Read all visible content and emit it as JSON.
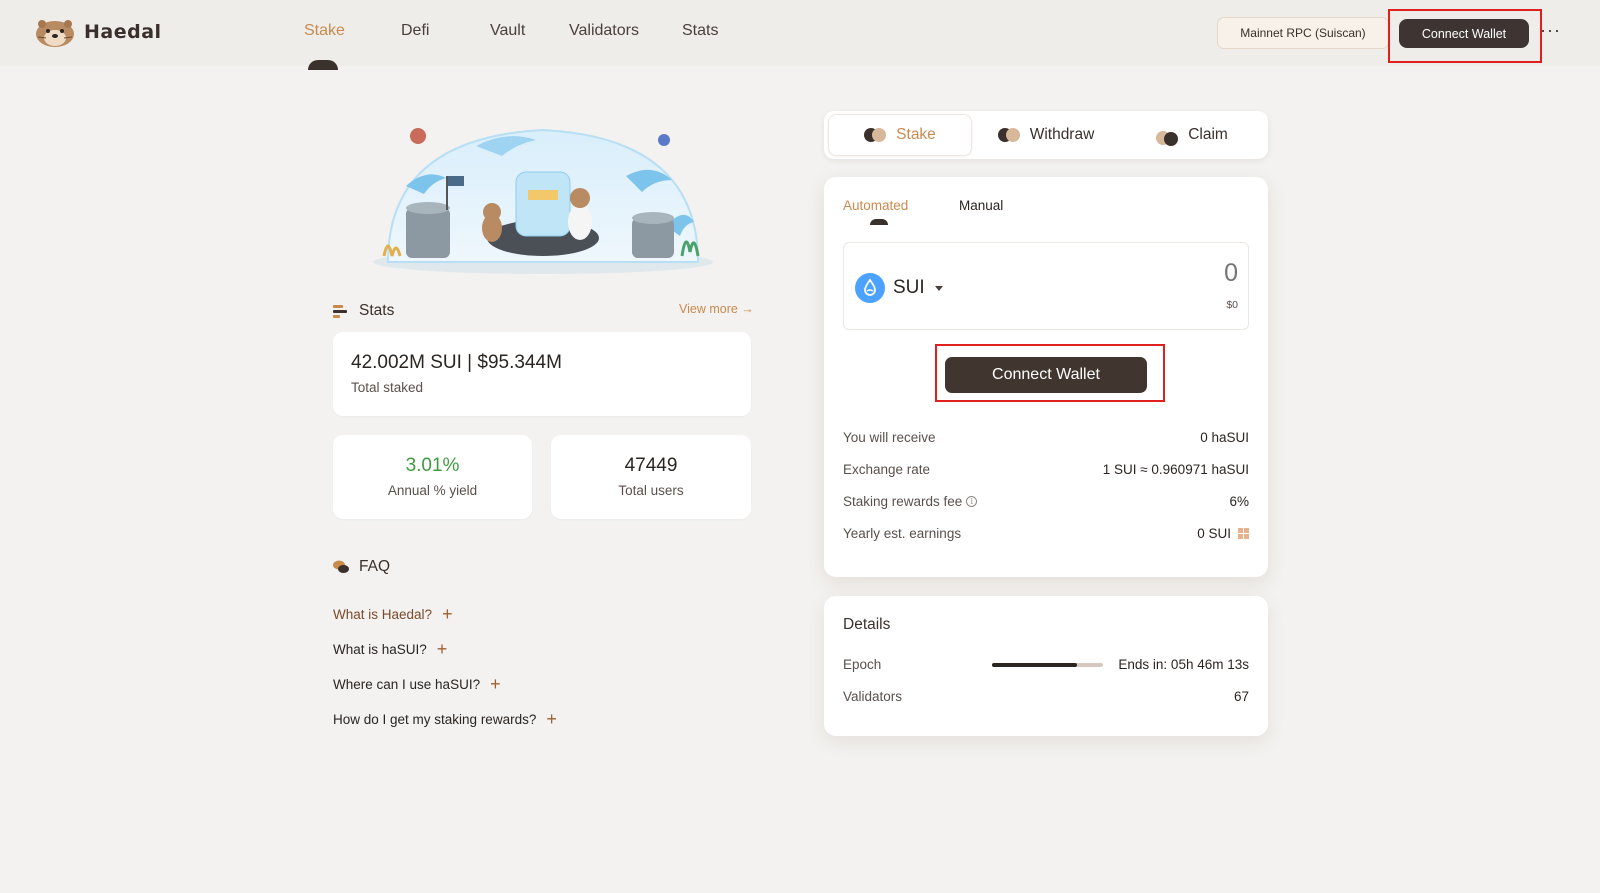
{
  "header": {
    "brand": "Haedal",
    "nav": [
      "Stake",
      "Defi",
      "Vault",
      "Validators",
      "Stats"
    ],
    "active_nav": "Stake",
    "rpc_label": "Mainnet RPC (Suiscan)",
    "connect_label": "Connect Wallet",
    "more_label": "···"
  },
  "stats": {
    "title": "Stats",
    "view_more": "View more →",
    "total_staked_value": "42.002M SUI | $95.344M",
    "total_staked_label": "Total staked",
    "apy_value": "3.01%",
    "apy_label": "Annual % yield",
    "users_value": "47449",
    "users_label": "Total users"
  },
  "faq": {
    "title": "FAQ",
    "items": [
      "What is Haedal?",
      "What is haSUI?",
      "Where can I use haSUI?",
      "How do I get my staking rewards?"
    ]
  },
  "action_tabs": [
    "Stake",
    "Withdraw",
    "Claim"
  ],
  "active_action_tab": "Stake",
  "stake_form": {
    "modes": [
      "Automated",
      "Manual"
    ],
    "active_mode": "Automated",
    "token": "SUI",
    "amount_placeholder": "0",
    "amount_usd": "$0",
    "connect_label": "Connect Wallet",
    "rows": {
      "receive_label": "You will receive",
      "receive_value": "0 haSUI",
      "rate_label": "Exchange rate",
      "rate_value": "1 SUI ≈ 0.960971 haSUI",
      "fee_label": "Staking rewards fee",
      "fee_value": "6%",
      "earnings_label": "Yearly est. earnings",
      "earnings_value": "0 SUI"
    }
  },
  "details": {
    "title": "Details",
    "epoch_label": "Epoch",
    "epoch_progress": 0.76,
    "epoch_value": "Ends in: 05h 46m 13s",
    "validators_label": "Validators",
    "validators_value": "67"
  },
  "colors": {
    "accent": "#c98a4e",
    "dark_button": "#3e3532",
    "apy_green": "#3f9a3f",
    "highlight_red": "#e01f1f",
    "sui_blue": "#4da2ff"
  }
}
